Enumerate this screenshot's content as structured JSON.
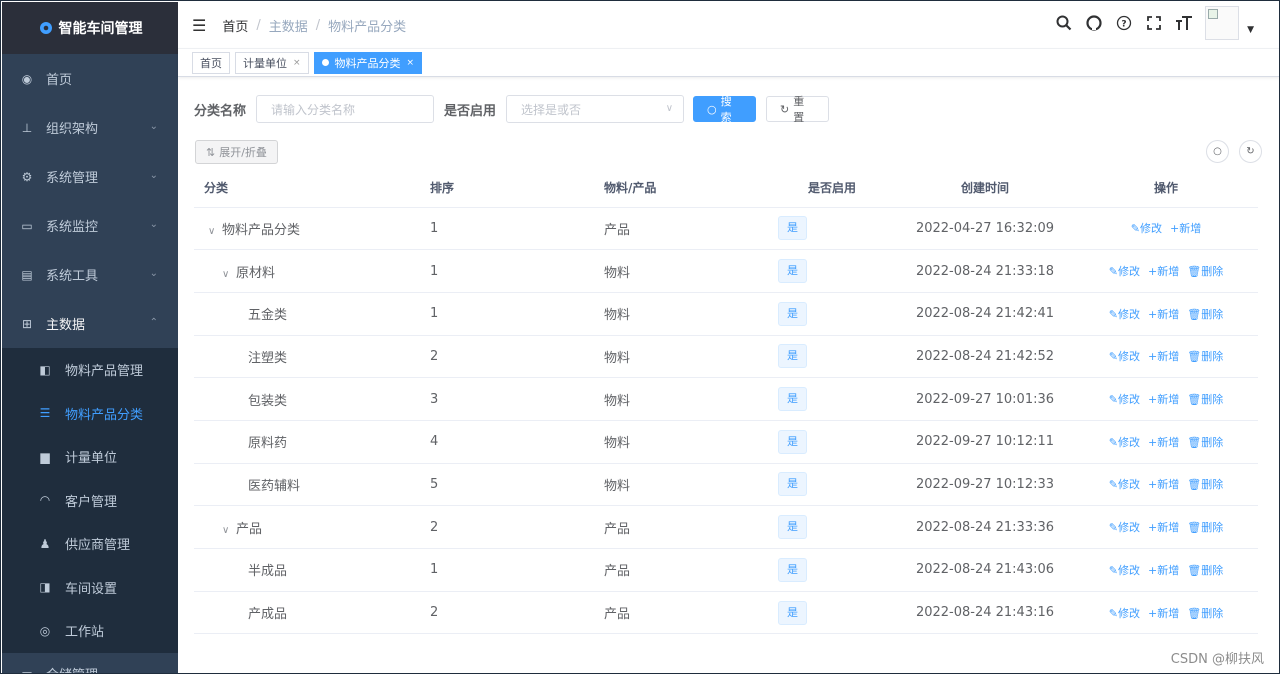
{
  "sidebar": {
    "title": "智能车间管理",
    "items": [
      {
        "label": "首页",
        "icon": "dashboard-icon",
        "glyph": "◉",
        "has_children": false
      },
      {
        "label": "组织架构",
        "icon": "tree-icon",
        "glyph": "⊥",
        "has_children": true
      },
      {
        "label": "系统管理",
        "icon": "gear-icon",
        "glyph": "⚙",
        "has_children": true
      },
      {
        "label": "系统监控",
        "icon": "monitor-icon",
        "glyph": "▭",
        "has_children": true
      },
      {
        "label": "系统工具",
        "icon": "tool-icon",
        "glyph": "▤",
        "has_children": true
      },
      {
        "label": "主数据",
        "icon": "table-icon",
        "glyph": "⊞",
        "has_children": true
      }
    ],
    "sub_items": [
      {
        "label": "物料产品管理",
        "icon": "book-icon",
        "glyph": "◧",
        "active": false
      },
      {
        "label": "物料产品分类",
        "icon": "list-icon",
        "glyph": "☰",
        "active": true
      },
      {
        "label": "计量单位",
        "icon": "clapper-icon",
        "glyph": "▆",
        "active": false
      },
      {
        "label": "客户管理",
        "icon": "headset-icon",
        "glyph": "◠",
        "active": false
      },
      {
        "label": "供应商管理",
        "icon": "users-icon",
        "glyph": "♟",
        "active": false
      },
      {
        "label": "车间设置",
        "icon": "factory-icon",
        "glyph": "◨",
        "active": false
      },
      {
        "label": "工作站",
        "icon": "station-icon",
        "glyph": "◎",
        "active": false
      }
    ],
    "cut_item": {
      "label": "仓储管理",
      "icon": "warehouse-icon",
      "glyph": "▦"
    }
  },
  "navbar": {
    "breadcrumb": [
      "首页",
      "主数据",
      "物料产品分类"
    ],
    "icons": [
      "search-icon",
      "github-icon",
      "question-icon",
      "fullscreen-icon",
      "font-size-icon"
    ]
  },
  "tags": [
    {
      "label": "首页",
      "active": false,
      "closable": false
    },
    {
      "label": "计量单位",
      "active": false,
      "closable": true
    },
    {
      "label": "物料产品分类",
      "active": true,
      "closable": true
    }
  ],
  "search": {
    "name_label": "分类名称",
    "name_placeholder": "请输入分类名称",
    "enable_label": "是否启用",
    "enable_placeholder": "选择是或否",
    "search_button": "搜索",
    "reset_button": "重置"
  },
  "toolbar": {
    "expand_button": "展开/折叠"
  },
  "table": {
    "columns": [
      "分类",
      "排序",
      "物料/产品",
      "是否启用",
      "创建时间",
      "操作"
    ],
    "rows": [
      {
        "name": "物料产品分类",
        "level": 0,
        "expanded": true,
        "sort": "1",
        "type": "产品",
        "enabled": "是",
        "created": "2022-04-27 16:32:09",
        "deletable": false
      },
      {
        "name": "原材料",
        "level": 1,
        "expanded": true,
        "sort": "1",
        "type": "物料",
        "enabled": "是",
        "created": "2022-08-24 21:33:18",
        "deletable": true
      },
      {
        "name": "五金类",
        "level": 2,
        "expanded": false,
        "sort": "1",
        "type": "物料",
        "enabled": "是",
        "created": "2022-08-24 21:42:41",
        "deletable": true
      },
      {
        "name": "注塑类",
        "level": 2,
        "expanded": false,
        "sort": "2",
        "type": "物料",
        "enabled": "是",
        "created": "2022-08-24 21:42:52",
        "deletable": true
      },
      {
        "name": "包装类",
        "level": 2,
        "expanded": false,
        "sort": "3",
        "type": "物料",
        "enabled": "是",
        "created": "2022-09-27 10:01:36",
        "deletable": true
      },
      {
        "name": "原料药",
        "level": 2,
        "expanded": false,
        "sort": "4",
        "type": "物料",
        "enabled": "是",
        "created": "2022-09-27 10:12:11",
        "deletable": true
      },
      {
        "name": "医药辅料",
        "level": 2,
        "expanded": false,
        "sort": "5",
        "type": "物料",
        "enabled": "是",
        "created": "2022-09-27 10:12:33",
        "deletable": true
      },
      {
        "name": "产品",
        "level": 1,
        "expanded": true,
        "sort": "2",
        "type": "产品",
        "enabled": "是",
        "created": "2022-08-24 21:33:36",
        "deletable": true
      },
      {
        "name": "半成品",
        "level": 2,
        "expanded": false,
        "sort": "1",
        "type": "产品",
        "enabled": "是",
        "created": "2022-08-24 21:43:06",
        "deletable": true
      },
      {
        "name": "产成品",
        "level": 2,
        "expanded": false,
        "sort": "2",
        "type": "产品",
        "enabled": "是",
        "created": "2022-08-24 21:43:16",
        "deletable": true
      }
    ],
    "actions": {
      "edit": "修改",
      "add": "新增",
      "delete": "删除"
    }
  },
  "watermark": "CSDN @柳扶风",
  "colors": {
    "primary": "#409eff",
    "sidebar": "#304156",
    "submenu": "#1f2d3d"
  }
}
